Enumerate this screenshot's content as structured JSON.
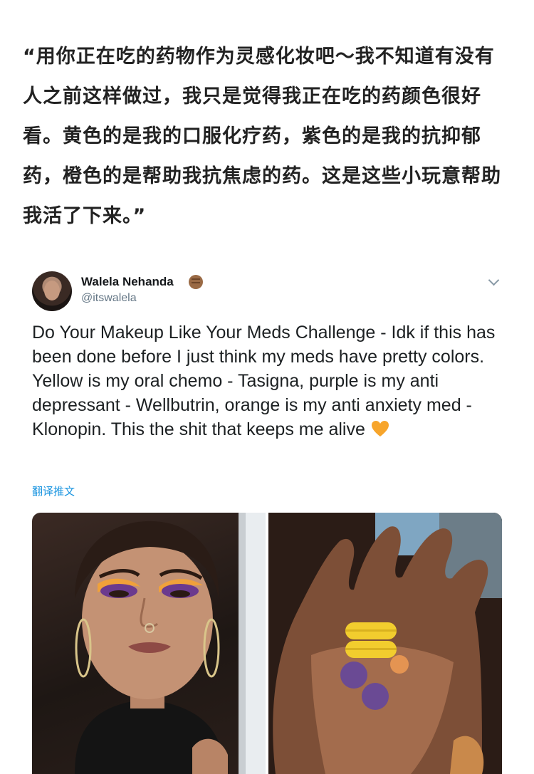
{
  "caption": "“用你正在吃的药物作为灵感化妆吧～我不知道有没有人之前这样做过，我只是觉得我正在吃的药颜色很好看。黄色的是我的口服化疗药，紫色的是我的抗抑郁药，橙色的是帮助我抗焦虑的药。这是这些小玩意帮助我活了下来。”",
  "tweet": {
    "display_name": "Walela Nehanda",
    "handle": "@itswalela",
    "text": "Do Your Makeup Like Your Meds Challenge - Idk if this has been done before I just think my meds have pretty colors. Yellow is my oral chemo - Tasigna, purple is my anti depressant - Wellbutrin, orange is my anti anxiety med - Klonopin. This the shit that keeps me alive",
    "translate_label": "翻译推文",
    "icons": {
      "badge": "raised-fist-emoji",
      "menu": "chevron-down-icon",
      "heart": "orange-heart-emoji"
    },
    "colors": {
      "link": "#1b95e0",
      "handle": "#657786",
      "heart": "#f7a52b"
    }
  }
}
